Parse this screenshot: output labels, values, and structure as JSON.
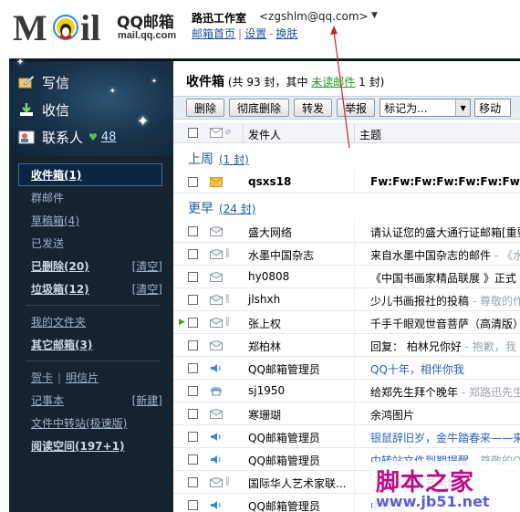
{
  "header": {
    "logo_text": "MOil",
    "brand": "QQ邮箱",
    "url": "mail.qq.com",
    "user_name": "路迅工作室",
    "user_email": "<zgshlm@qq.com>",
    "user_menu_glyph": "▼",
    "nav": {
      "home": "邮箱首页",
      "settings": "设置",
      "switch": "换肤"
    }
  },
  "leftbar": {
    "compose": "写信",
    "inbox": "收信",
    "contacts": "联系人",
    "contacts_count": "48",
    "folders": [
      {
        "label": "收件箱(1)",
        "active": true
      },
      {
        "label": "群邮件"
      },
      {
        "label": "草稿箱(4)"
      },
      {
        "label": "已发送"
      },
      {
        "label": "已删除(20)",
        "right": "[清空]",
        "bold": true
      },
      {
        "label": "垃圾箱(12)",
        "right": "[清空]",
        "bold": true
      }
    ],
    "folders2": [
      {
        "label": "我的文件夹"
      },
      {
        "label": "其它邮箱(3)",
        "bold": true
      }
    ],
    "extras": {
      "card": "贺卡",
      "postcard": "明信片",
      "notebook": "记事本",
      "notebook_new": "[新建]",
      "transfer": "文件中转站(极速版)",
      "reading": "阅读空间(197+1)"
    }
  },
  "main": {
    "title": "收件箱",
    "title_prefix": "(共",
    "total": "93",
    "mid": "封，其中",
    "unread_link": "未读邮件",
    "unread_count": "1",
    "suffix": "封)",
    "toolbar": {
      "delete": "删除",
      "purge": "彻底删除",
      "forward": "转发",
      "report": "举报",
      "mark_as": "标记为...",
      "move": "移动"
    },
    "columns": {
      "from": "发件人",
      "subject": "主题"
    },
    "groups": {
      "lastweek": {
        "label": "上周",
        "count": "(1 封)"
      },
      "earlier": {
        "label": "更早",
        "count": "(24 封)"
      }
    },
    "lastweek_rows": [
      {
        "from": "qsxs18",
        "subject": "Fw:Fw:Fw:Fw:Fw:Fw:Fw",
        "icon": "unread-mail",
        "bold": true
      }
    ],
    "rows": [
      {
        "from": "盛大网络",
        "subject": "请认证您的盛大通行证邮箱[重要]",
        "pre": "",
        "icon": "read-mail"
      },
      {
        "from": "水墨中国杂志",
        "subject": "来自水墨中国杂志的邮件",
        "pre": " - 《水",
        "icon": "read-mail-attach"
      },
      {
        "from": "hy0808",
        "subject": "《中国书画家精品联展 》正式",
        "pre": "",
        "icon": "read-mail"
      },
      {
        "from": "jlshxh",
        "subject": "少儿书画报社的投稿",
        "pre": " - 尊敬的作",
        "icon": "read-mail-attach"
      },
      {
        "from": "张上权",
        "subject": "千手千眼观世音菩萨（高清版）",
        "pre": "",
        "icon": "read-mail-attach",
        "flag": true
      },
      {
        "from": "郑柏林",
        "subject": "回复： 柏林兄你好",
        "pre": " - 抱歉，我",
        "icon": "read-mail"
      },
      {
        "from": "QQ邮箱管理员",
        "subject": "QQ十年，相伴你我",
        "pre": "",
        "icon": "speaker",
        "blue": true
      },
      {
        "from": "sj1950",
        "subject": "给郑先生拜个晚年",
        "pre": " - 郑路迅先生",
        "icon": "cloud-mail"
      },
      {
        "from": "寒珊瑚",
        "subject": "余鸿图片",
        "pre": "",
        "icon": "read-mail"
      },
      {
        "from": "QQ邮箱管理员",
        "subject": "银鼠辞旧岁，金牛踏春来——来",
        "pre": "",
        "icon": "speaker",
        "blue": true
      },
      {
        "from": "QQ邮箱管理员",
        "subject": "中转站文件到期提醒",
        "pre": " - 尊敬的QQ",
        "icon": "speaker",
        "blue": true
      },
      {
        "from": "国际华人艺术家联...",
        "subject": "《国际华人艺术家",
        "pre": "",
        "icon": "read-mail-attach"
      },
      {
        "from": "QQ邮箱管理员",
        "subject": "中转站",
        "pre": "",
        "icon": "speaker",
        "blue": true
      }
    ]
  },
  "watermark": {
    "title": "脚本之家",
    "url": "www.jb51.net"
  },
  "colors": {
    "sidebar": "#15232f",
    "accent": "#1e5a9e",
    "annotation": "#c9252b"
  }
}
